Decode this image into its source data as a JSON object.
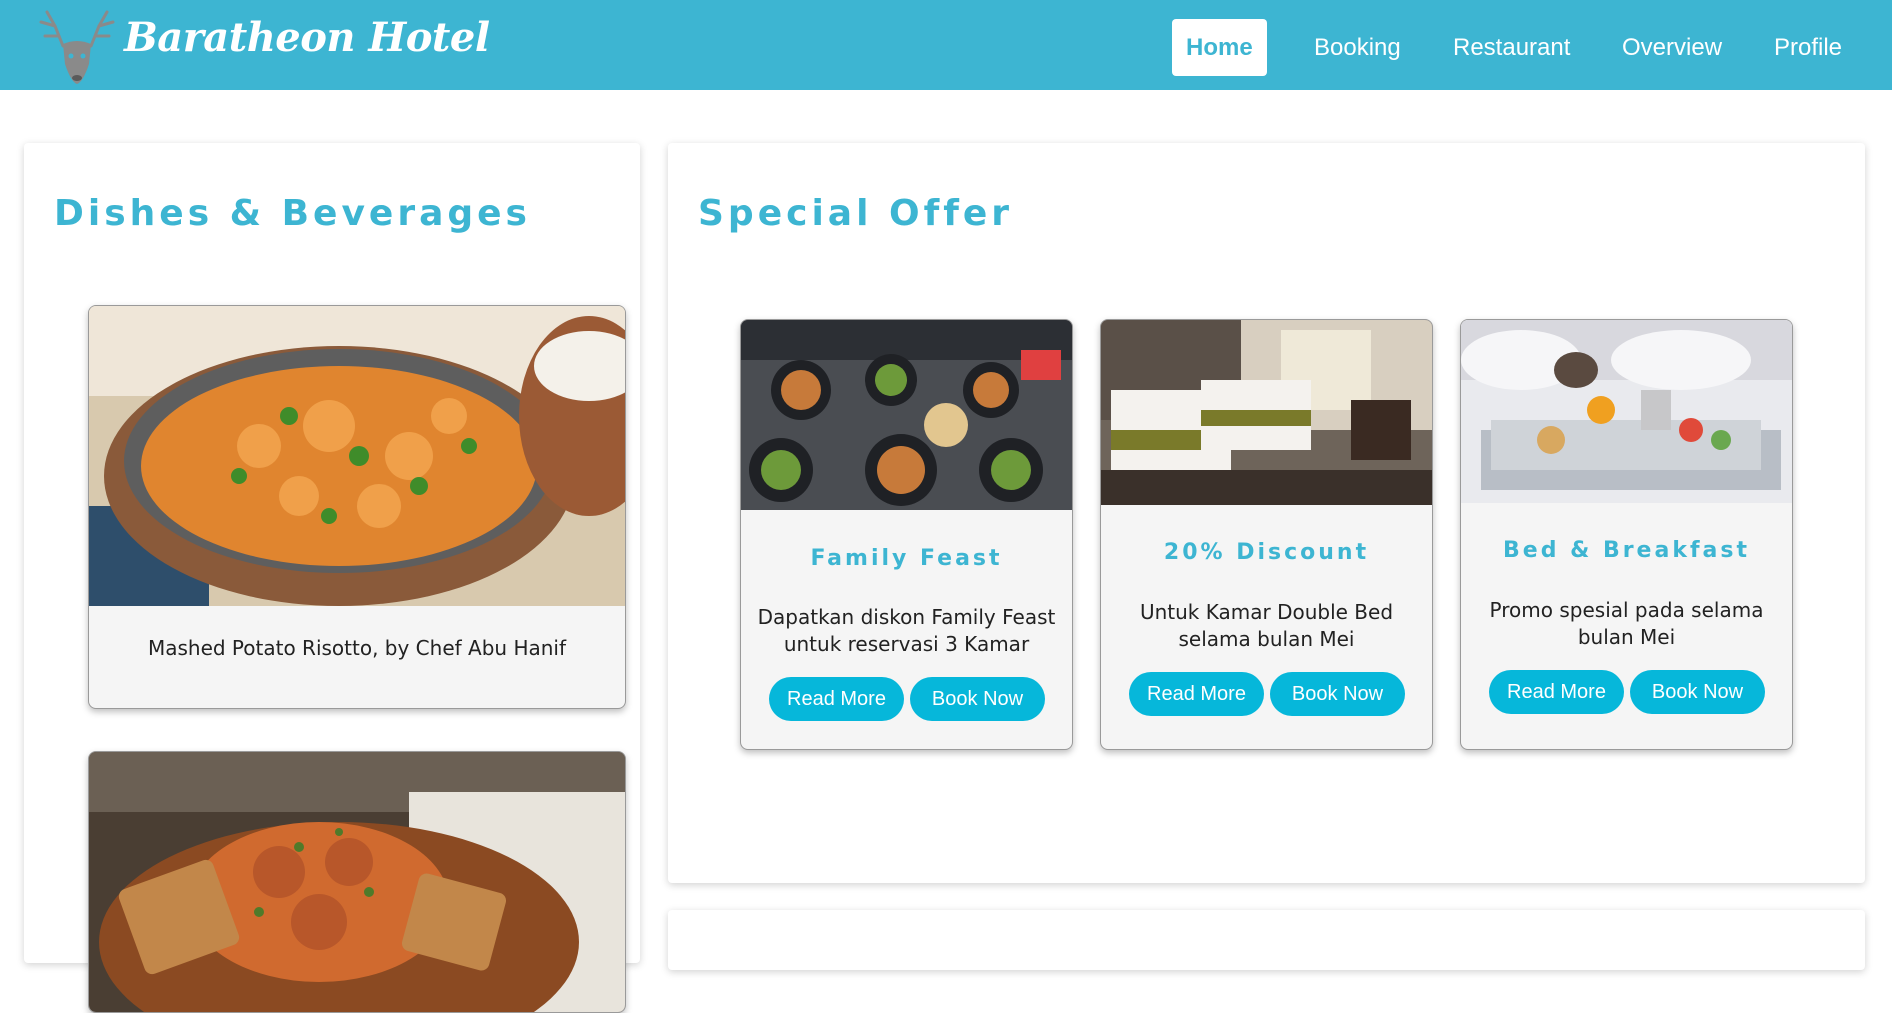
{
  "header": {
    "brand": "Baratheon Hotel",
    "logo_icon": "deer-head-icon",
    "nav": [
      "Home",
      "Booking",
      "Restaurant",
      "Overview",
      "Profile"
    ],
    "active_nav": "Home"
  },
  "dishes": {
    "title": "Dishes & Beverages",
    "items": [
      {
        "caption": "Mashed Potato Risotto, by Chef Abu Hanif",
        "image": "curry-dish-photo"
      },
      {
        "caption": "",
        "image": "toast-bacon-dish-photo"
      }
    ]
  },
  "offers": {
    "title": "Special Offer",
    "cards": [
      {
        "title": "Family Feast",
        "desc": "Dapatkan diskon Family Feast untuk reservasi 3 Kamar",
        "read_more": "Read More",
        "book_now": "Book Now",
        "image": "family-feast-table-photo"
      },
      {
        "title": "20% Discount",
        "desc": "Untuk Kamar Double Bed selama bulan Mei",
        "read_more": "Read More",
        "book_now": "Book Now",
        "image": "double-bed-room-photo"
      },
      {
        "title": "Bed & Breakfast",
        "desc": "Promo spesial pada selama bulan Mei",
        "read_more": "Read More",
        "book_now": "Book Now",
        "image": "breakfast-tray-photo"
      }
    ]
  },
  "colors": {
    "primary": "#3db5d2",
    "button": "#06b7da",
    "card_bg": "#f5f5f5"
  }
}
